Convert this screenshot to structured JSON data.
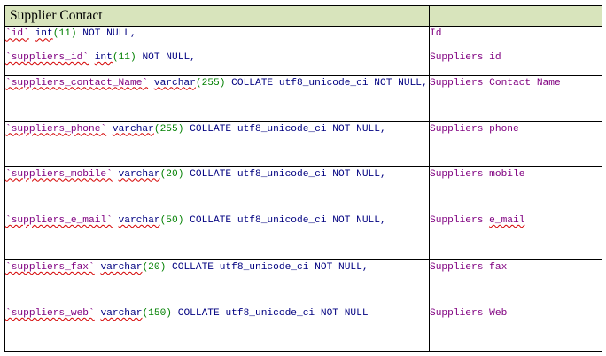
{
  "table": {
    "title": "Supplier Contact",
    "rows": [
      {
        "name": "`id`",
        "type": "int",
        "size": "(11)",
        "tail": " NOT NULL,",
        "desc": "Id"
      },
      {
        "name": "`suppliers_id`",
        "type": "int",
        "size": "(11)",
        "tail": " NOT NULL,",
        "desc": "Suppliers id"
      },
      {
        "name": "`suppliers_contact_Name`",
        "type": "varchar",
        "size": "(255)",
        "tail": " COLLATE utf8_unicode_ci NOT NULL,",
        "desc": "Suppliers Contact Name"
      },
      {
        "name": "`suppliers_phone`",
        "type": "varchar",
        "size": "(255)",
        "tail": " COLLATE utf8_unicode_ci NOT NULL,",
        "desc": "Suppliers phone"
      },
      {
        "name": "`suppliers_mobile`",
        "type": "varchar",
        "size": "(20)",
        "tail": " COLLATE utf8_unicode_ci NOT NULL,",
        "desc": "Suppliers mobile"
      },
      {
        "name": "`suppliers_e_mail`",
        "type": "varchar",
        "size": "(50)",
        "tail": " COLLATE utf8_unicode_ci NOT NULL,",
        "desc_prefix": "Suppliers ",
        "desc_underlined": "e_mail"
      },
      {
        "name": "`suppliers_fax`",
        "type": "varchar",
        "size": "(20)",
        "tail": " COLLATE utf8_unicode_ci NOT NULL,",
        "desc": "Suppliers fax"
      },
      {
        "name": "`suppliers_web`",
        "type": "varchar",
        "size": "(150)",
        "tail": " COLLATE utf8_unicode_ci NOT NULL",
        "desc": "Suppliers Web"
      }
    ]
  }
}
